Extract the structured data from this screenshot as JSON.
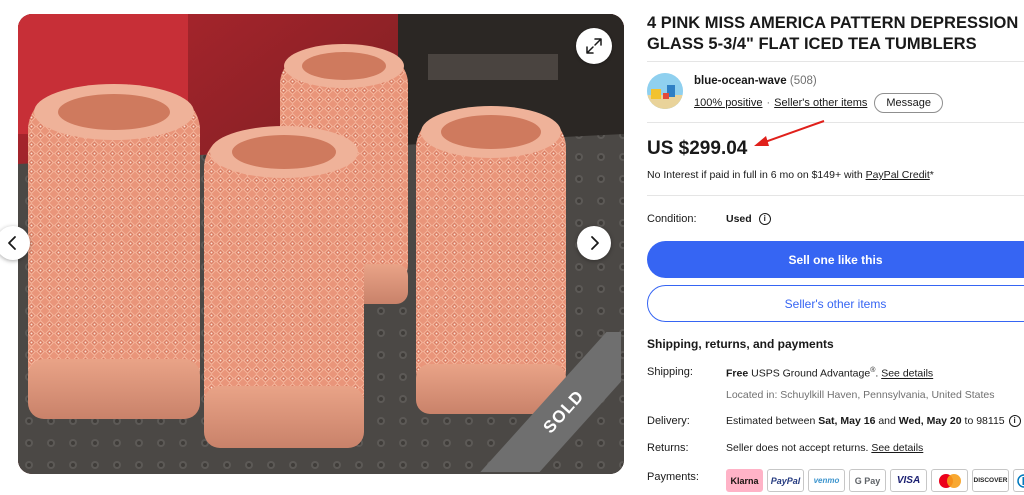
{
  "listing": {
    "title": "4 PINK MISS AMERICA PATTERN DEPRESSION GLASS 5-3/4\" FLAT ICED TEA TUMBLERS",
    "sold_badge": "SOLD"
  },
  "seller": {
    "name": "blue-ocean-wave",
    "feedback_count": "(508)",
    "positive": "100% positive",
    "other_items": "Seller's other items",
    "message": "Message"
  },
  "price": {
    "amount": "US $299.04",
    "finance_text": "No Interest if paid in full in 6 mo on $149+ with ",
    "finance_link": "PayPal Credit",
    "finance_suffix": "*"
  },
  "condition": {
    "label": "Condition:",
    "value": "Used"
  },
  "actions": {
    "primary": "Sell one like this",
    "secondary": "Seller's other items"
  },
  "details": {
    "heading": "Shipping, returns, and payments",
    "shipping_label": "Shipping:",
    "shipping_free": "Free",
    "shipping_service": "USPS Ground Advantage",
    "shipping_reg": "®",
    "shipping_link": "See details",
    "shipping_location": "Located in: Schuylkill Haven, Pennsylvania, United States",
    "delivery_label": "Delivery:",
    "delivery_prefix": "Estimated between ",
    "delivery_start": "Sat, May 16",
    "delivery_and": " and ",
    "delivery_end": "Wed, May 20",
    "delivery_suffix": " to 98115",
    "returns_label": "Returns:",
    "returns_text": "Seller does not accept returns.",
    "returns_link": "See details",
    "payments_label": "Payments:"
  },
  "payment_methods": {
    "klarna": "Klarna",
    "paypal": "PayPal",
    "venmo": "venmo",
    "gpay": "G Pay",
    "visa": "VISA",
    "discover": "DISCOVER"
  },
  "colors": {
    "accent": "#3665f3",
    "annotation_arrow": "#e0201b"
  }
}
